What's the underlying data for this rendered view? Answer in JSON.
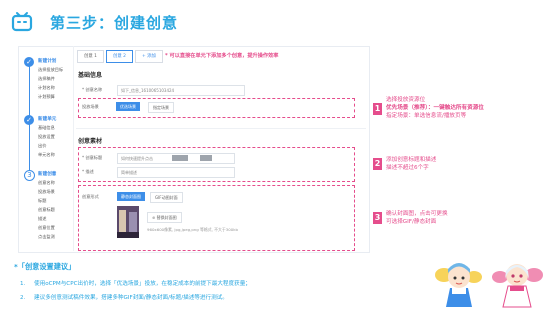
{
  "header": {
    "title": "第三步：创建创意"
  },
  "sidebar": {
    "groups": [
      {
        "head": "新建计划",
        "items": [
          "选择投放目标",
          "选择稿件",
          "计划名称",
          "计划预算"
        ]
      },
      {
        "head": "新建单元",
        "items": [
          "基础信息",
          "投放设置",
          "出价",
          "单元名称"
        ]
      },
      {
        "head": "新建创意",
        "items": [
          "创意名称",
          "投放场景",
          "标题",
          "创意标题",
          "描述",
          "创意位置",
          "点击监测"
        ]
      }
    ],
    "step3_number": "3"
  },
  "tabs": {
    "items": [
      "创意 1",
      "创意 2",
      "+ 添加"
    ]
  },
  "hint": "* 可以直接在单元下添加多个创意，提升操作效率",
  "basic": {
    "title": "基础信息",
    "name_label": "* 创意名称",
    "name_value": "如下_信息_1610065103424",
    "scene_label": "投放场景",
    "scene_options": [
      "优选场景",
      "指定场景"
    ]
  },
  "material": {
    "title": "创意素材",
    "title_label": "* 创意标题",
    "title_value": "如何快速提升点击",
    "desc_label": "* 描述",
    "desc_value": "简单描述",
    "form_label": "创意形式",
    "form_options": [
      "静态封面图",
      "GIF动图封面"
    ],
    "upload_label": "替换封面图",
    "upload_note": "960x600像素, jpg,jpeg,png 等格式, 不大于300kb"
  },
  "annotations": [
    {
      "num": "1",
      "lines": [
        "选择投放资源位",
        "优先场景（推荐）：一键触达所有资源位",
        "指定场景：单选信息流/播放页等"
      ]
    },
    {
      "num": "2",
      "lines": [
        "添加创意标题和描述",
        "描述不超过6个字"
      ]
    },
    {
      "num": "3",
      "lines": [
        "确认封面图，点击可更换",
        "可选择GIF/静态封面"
      ]
    }
  ],
  "tips": {
    "title": "*「创意设置建议」",
    "items": [
      {
        "num": "1.",
        "text": "使用oCPM与CPC出价时，选择「优选场景」投放，在稳定成本的前提下最大程度获量；"
      },
      {
        "num": "2.",
        "text": "建议多创意测试稿件效果，搭建多种GIF封面/静态封面/标题/描述等进行测试。"
      }
    ]
  },
  "colors": {
    "brand_blue": "#2aa7e0",
    "accent_pink": "#e54d8c",
    "ui_blue": "#3d8ee8"
  }
}
